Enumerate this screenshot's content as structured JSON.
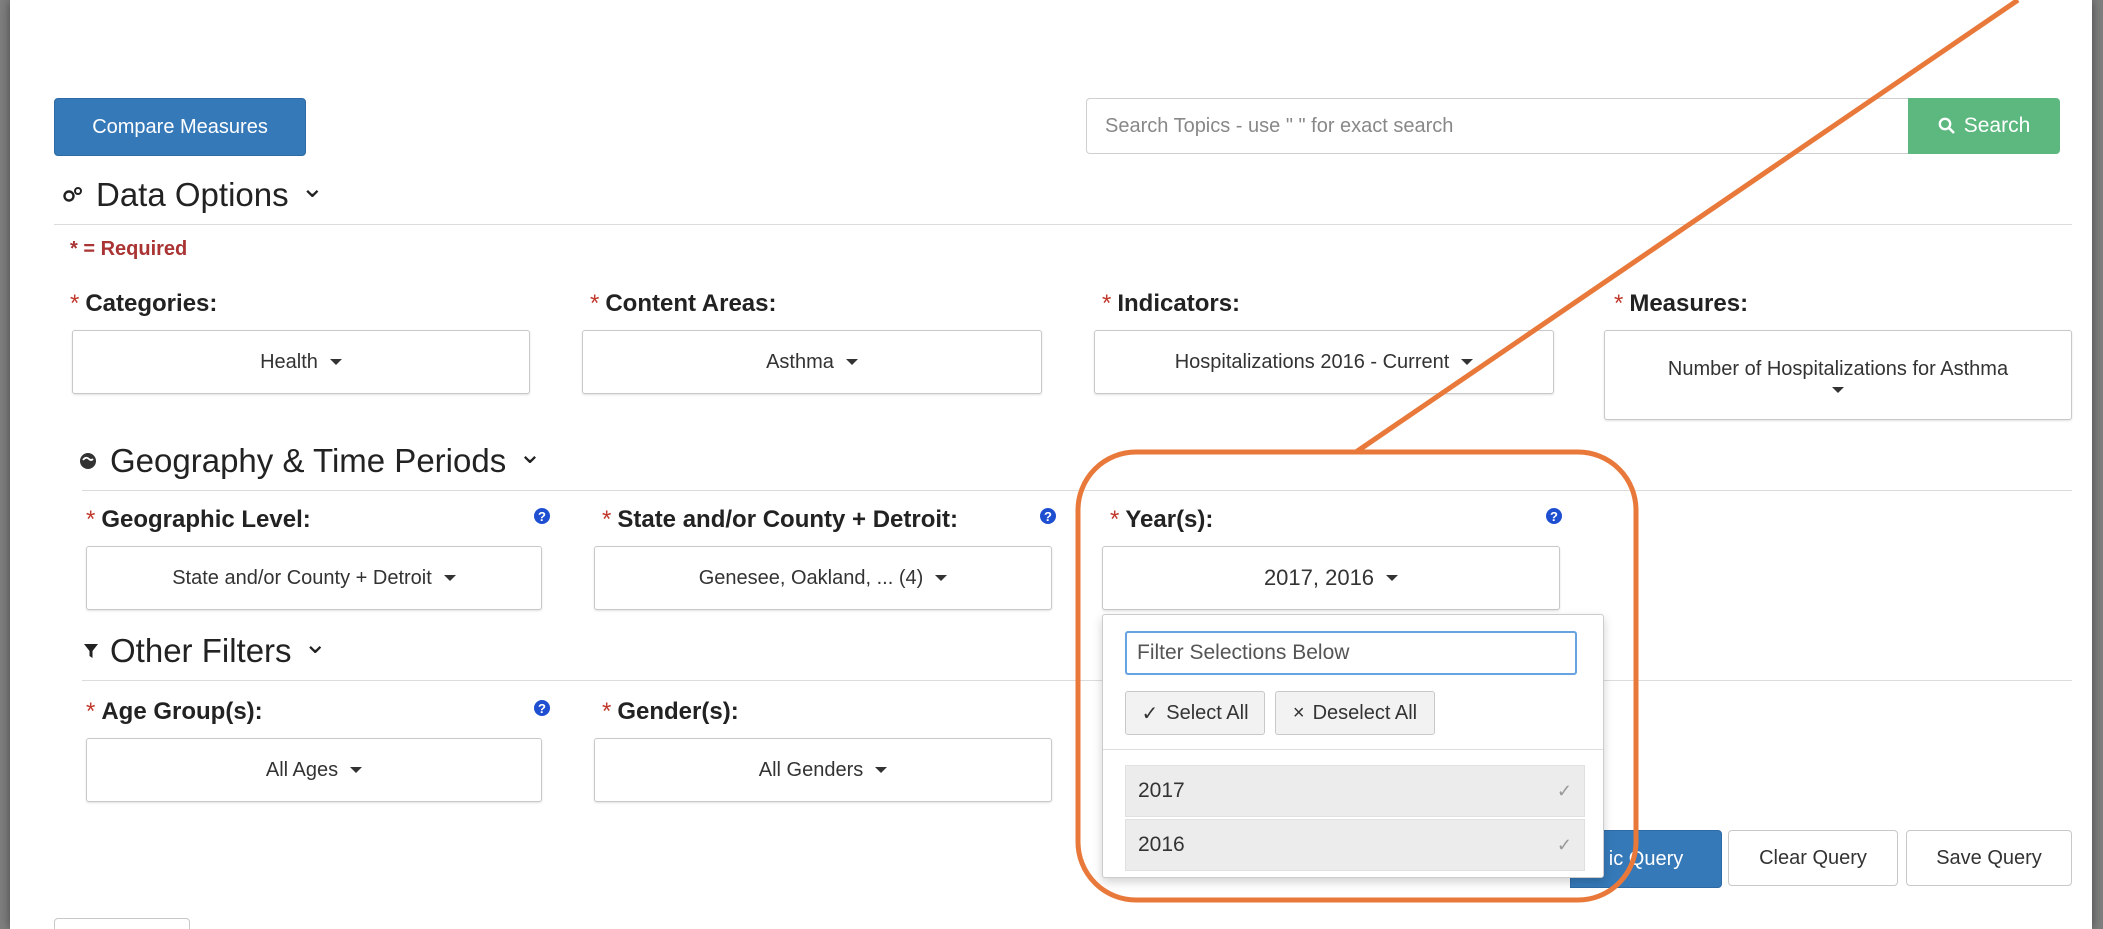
{
  "colors": {
    "primary": "#3579b8",
    "search_button": "#5cb87f",
    "required": "#c0392b",
    "highlight_callout": "#e8793a",
    "help_icon": "#1f4fd1"
  },
  "toolbar": {
    "compare_label": "Compare Measures",
    "search_placeholder": "Search Topics - use \" \" for exact search",
    "search_label": "Search",
    "search_icon": "search-icon"
  },
  "data_options": {
    "title": "Data Options",
    "icon": "gears-icon",
    "required_note": "* = Required",
    "fields": [
      {
        "label": "Categories:",
        "value": "Health"
      },
      {
        "label": "Content Areas:",
        "value": "Asthma"
      },
      {
        "label": "Indicators:",
        "value": "Hospitalizations 2016 - Current"
      },
      {
        "label": "Measures:",
        "value": "Number of Hospitalizations for Asthma"
      }
    ]
  },
  "geography": {
    "title": "Geography & Time Periods",
    "icon": "globe-icon",
    "fields": [
      {
        "label": "Geographic Level:",
        "value": "State and/or County + Detroit"
      },
      {
        "label": "State and/or County + Detroit:",
        "value": "Genesee, Oakland, ... (4)"
      },
      {
        "label": "Year(s):",
        "value": "2017, 2016"
      }
    ]
  },
  "other_filters": {
    "title": "Other Filters",
    "icon": "filter-icon",
    "fields": [
      {
        "label": "Age Group(s):",
        "value": "All Ages"
      },
      {
        "label": "Gender(s):",
        "value": "All Genders"
      }
    ]
  },
  "year_dropdown": {
    "filter_placeholder": "Filter Selections Below",
    "select_all": "Select All",
    "deselect_all": "Deselect All",
    "options": [
      {
        "label": "2017",
        "selected": true
      },
      {
        "label": "2016",
        "selected": true
      }
    ]
  },
  "actions": {
    "run_partial": "ic Query",
    "clear": "Clear Query",
    "save": "Save Query"
  },
  "glyphs": {
    "chevron": "⌄",
    "check": "✓",
    "times": "×",
    "help": "?",
    "required_star": "*"
  }
}
